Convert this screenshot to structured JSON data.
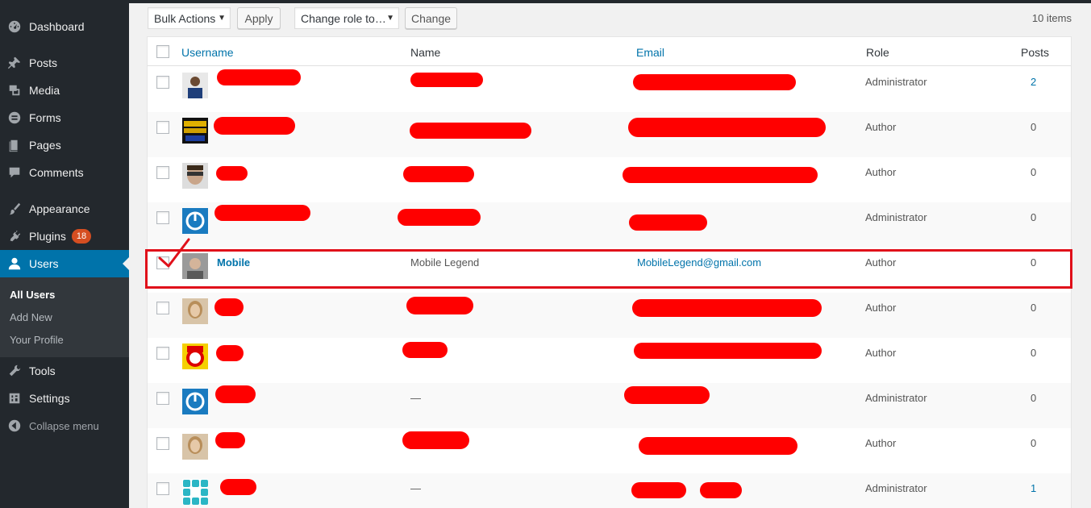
{
  "sidebar": {
    "items": [
      {
        "label": "Dashboard",
        "icon": "dashboard-icon"
      },
      {
        "label": "Posts",
        "icon": "pushpin-icon"
      },
      {
        "label": "Media",
        "icon": "media-icon"
      },
      {
        "label": "Forms",
        "icon": "forms-icon"
      },
      {
        "label": "Pages",
        "icon": "pages-icon"
      },
      {
        "label": "Comments",
        "icon": "comments-icon"
      },
      {
        "label": "Appearance",
        "icon": "paintbrush-icon"
      },
      {
        "label": "Plugins",
        "icon": "plugin-icon",
        "badge": "18"
      },
      {
        "label": "Users",
        "icon": "user-icon",
        "active": true
      },
      {
        "label": "Tools",
        "icon": "wrench-icon"
      },
      {
        "label": "Settings",
        "icon": "settings-icon"
      }
    ],
    "submenu": [
      "All Users",
      "Add New",
      "Your Profile"
    ],
    "collapse_label": "Collapse menu"
  },
  "tablenav": {
    "bulk_actions": "Bulk Actions",
    "apply": "Apply",
    "change_role": "Change role to…",
    "change": "Change",
    "items_count": "10 items"
  },
  "table": {
    "headers": {
      "username": "Username",
      "name": "Name",
      "email": "Email",
      "role": "Role",
      "posts": "Posts"
    },
    "rows": [
      {
        "username": "",
        "name": "",
        "email": "",
        "role": "Administrator",
        "posts": "2"
      },
      {
        "username": "",
        "name": "",
        "email": "",
        "role": "Author",
        "posts": "0"
      },
      {
        "username": "",
        "name": "",
        "email": "",
        "role": "Author",
        "posts": "0"
      },
      {
        "username": "",
        "name": "",
        "email": "",
        "role": "Administrator",
        "posts": "0"
      },
      {
        "username": "Mobile",
        "name": "Mobile Legend",
        "email": "MobileLegend@gmail.com",
        "role": "Author",
        "posts": "0"
      },
      {
        "username": "",
        "name": "",
        "email": "",
        "role": "Author",
        "posts": "0"
      },
      {
        "username": "",
        "name": "",
        "email": "",
        "role": "Author",
        "posts": "0"
      },
      {
        "username": "",
        "name": "—",
        "email": "",
        "role": "Administrator",
        "posts": "0"
      },
      {
        "username": "",
        "name": "",
        "email": "",
        "role": "Author",
        "posts": "0"
      },
      {
        "username": "",
        "name": "—",
        "email": "",
        "role": "Administrator",
        "posts": "1"
      }
    ]
  },
  "colors": {
    "accent": "#0073aa",
    "sidebar": "#23282d",
    "redaction": "#ff0000",
    "highlight": "#e0101a",
    "badge": "#d54e21"
  }
}
